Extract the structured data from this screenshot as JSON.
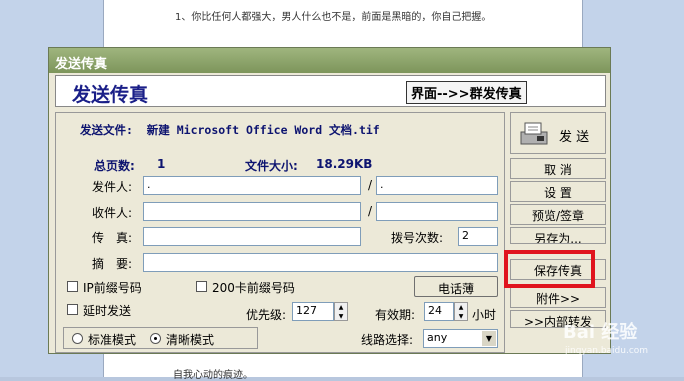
{
  "document": {
    "line_top": "1、你比任何人都强大，男人什么也不是，前面是黑暗的，你自己把握。",
    "line_bottom": "自我心动的痕迹。"
  },
  "watermark": {
    "text": "Bai 经验",
    "sub": "jingyan.baidu.com"
  },
  "window": {
    "title": "发送传真"
  },
  "header": {
    "title": "发送传真",
    "mode_link": "界面-->>群发传真"
  },
  "file": {
    "label": "发送文件:",
    "name": "新建 Microsoft Office Word 文档.tif"
  },
  "stats": {
    "pages_label": "总页数:",
    "pages": "1",
    "size_label": "文件大小:",
    "size": "18.29KB"
  },
  "form": {
    "sender_label": "发件人:",
    "sender_value": ".",
    "sender_sep": "/",
    "sender_value2": ".",
    "recipient_label": "收件人:",
    "recipient_sep": "/",
    "fax_label": "传　真:",
    "fax_value": "",
    "redial_label": "拨号次数:",
    "redial_value": "2",
    "summary_label": "摘　要:",
    "summary_value": ""
  },
  "options": {
    "ip_prefix": "IP前缀号码",
    "card_prefix": "200卡前缀号码",
    "phonebook_button": "电话薄",
    "delay_send": "延时发送",
    "priority_label": "优先级:",
    "priority_value": "127",
    "valid_label": "有效期:",
    "valid_value": "24",
    "valid_unit": "小时",
    "mode_standard": "标准模式",
    "mode_clear": "清晰模式",
    "selected_mode": "清晰模式",
    "line_label": "线路选择:",
    "line_value": "any"
  },
  "side_buttons": {
    "send": "发 送",
    "cancel": "取 消",
    "settings": "设 置",
    "preview": "预览/签章",
    "save_as": "另存为...",
    "save_fax": "保存传真",
    "attachment": "附件>>",
    "internal": ">>内部转发"
  },
  "colors": {
    "title_bar": "#8aa46a",
    "header_text": "#1a1f88",
    "highlight": "#e0141e"
  }
}
